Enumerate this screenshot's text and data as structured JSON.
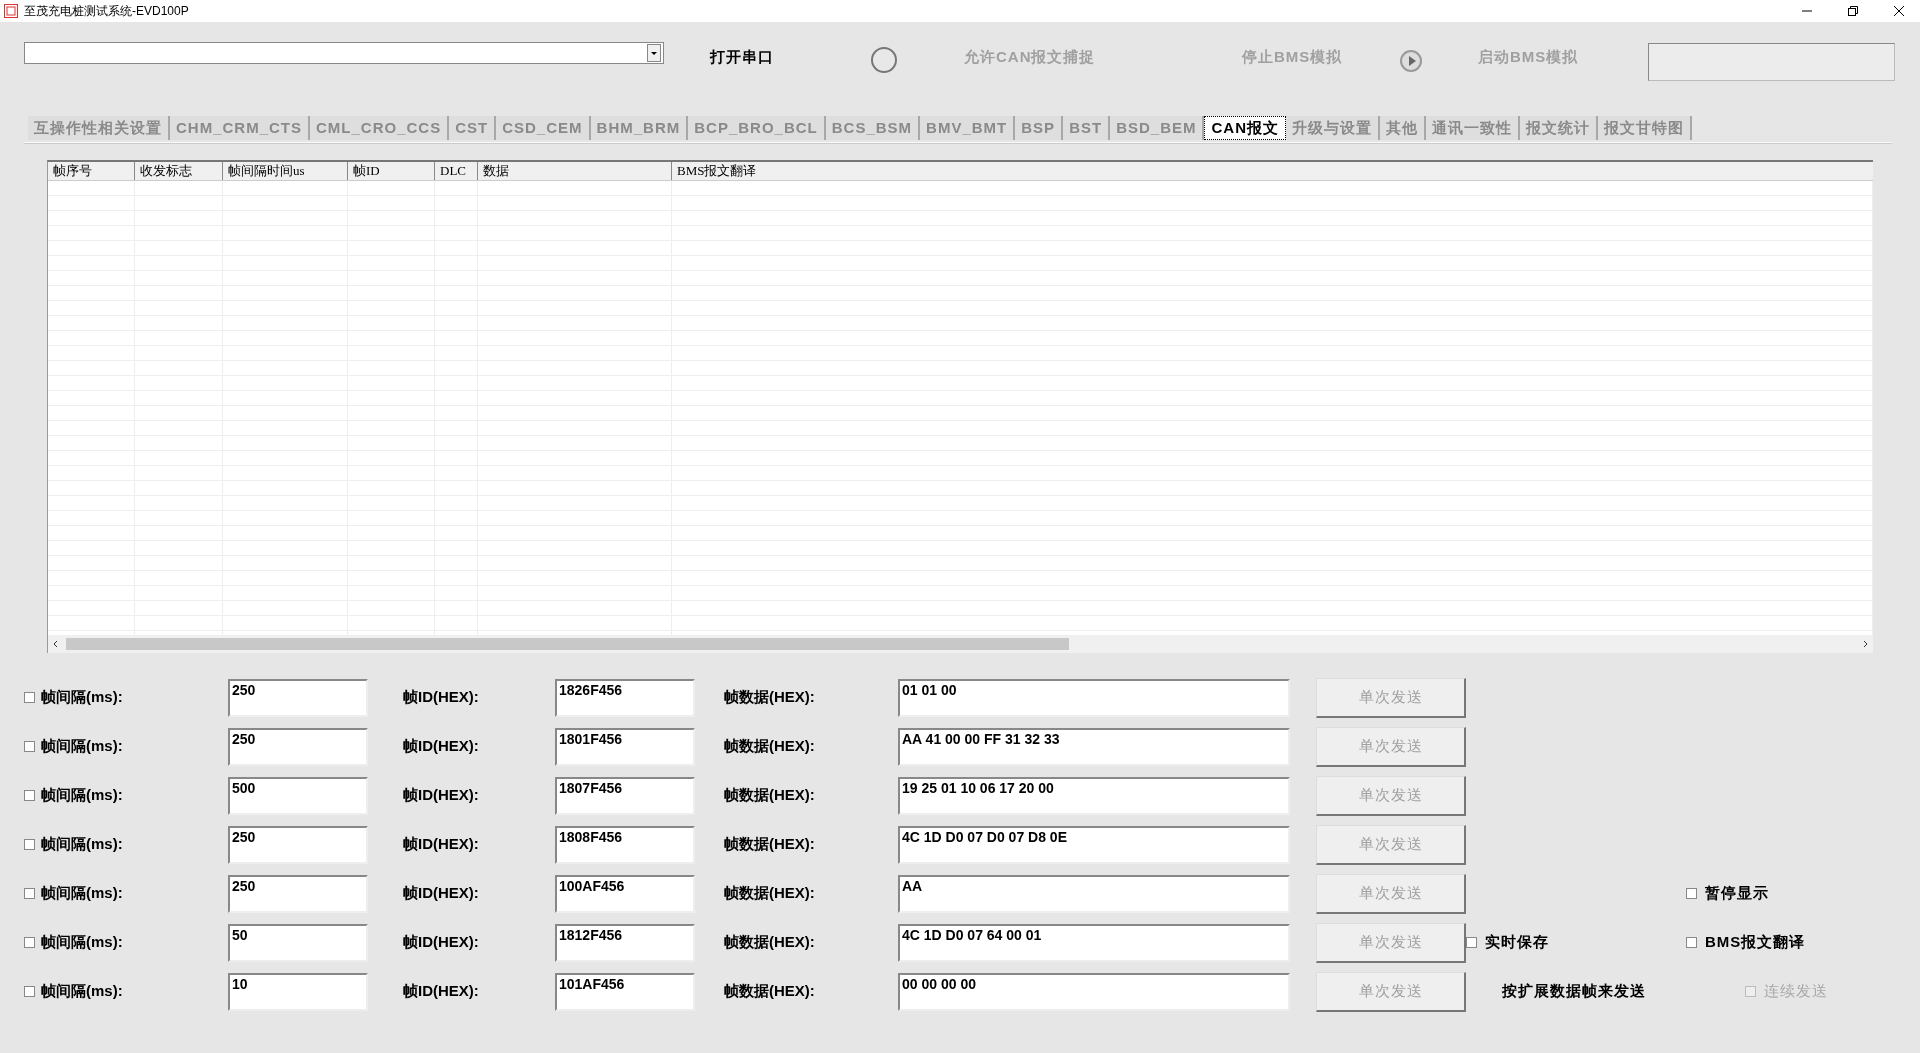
{
  "window": {
    "title": "至茂充电桩测试系统-EVD100P"
  },
  "toolbar": {
    "open_port": {
      "label": "打开串口",
      "disabled": false
    },
    "capture": {
      "label": "允许CAN报文捕捉",
      "disabled": true
    },
    "stop_bms": {
      "label": "停止BMS模拟",
      "disabled": true
    },
    "start_bms": {
      "label": "启动BMS模拟",
      "disabled": true
    }
  },
  "tabs": [
    {
      "label": "互操作性相关设置",
      "selected": false
    },
    {
      "label": "CHM_CRM_CTS",
      "selected": false
    },
    {
      "label": "CML_CRO_CCS",
      "selected": false
    },
    {
      "label": "CST",
      "selected": false
    },
    {
      "label": "CSD_CEM",
      "selected": false
    },
    {
      "label": "BHM_BRM",
      "selected": false
    },
    {
      "label": "BCP_BRO_BCL",
      "selected": false
    },
    {
      "label": "BCS_BSM",
      "selected": false
    },
    {
      "label": "BMV_BMT",
      "selected": false
    },
    {
      "label": "BSP",
      "selected": false
    },
    {
      "label": "BST",
      "selected": false
    },
    {
      "label": "BSD_BEM",
      "selected": false
    },
    {
      "label": "CAN报文",
      "selected": true
    },
    {
      "label": "升级与设置",
      "selected": false
    },
    {
      "label": "其他",
      "selected": false
    },
    {
      "label": "通讯一致性",
      "selected": false
    },
    {
      "label": "报文统计",
      "selected": false
    },
    {
      "label": "报文甘特图",
      "selected": false
    }
  ],
  "table": {
    "columns": [
      "帧序号",
      "收发标志",
      "帧间隔时间us",
      "帧ID",
      "DLC",
      "数据",
      "BMS报文翻译"
    ]
  },
  "send_rows": [
    {
      "checked": false,
      "interval_label": "帧间隔(ms):",
      "interval": "250",
      "id_label": "帧ID(HEX):",
      "id": "1826F456",
      "data_label": "帧数据(HEX):",
      "data": "01 01 00",
      "button": {
        "label": "单次发送",
        "disabled": true
      }
    },
    {
      "checked": false,
      "interval_label": "帧间隔(ms):",
      "interval": "250",
      "id_label": "帧ID(HEX):",
      "id": "1801F456",
      "data_label": "帧数据(HEX):",
      "data": "AA 41 00 00 FF 31 32 33",
      "button": {
        "label": "单次发送",
        "disabled": true
      }
    },
    {
      "checked": false,
      "interval_label": "帧间隔(ms):",
      "interval": "500",
      "id_label": "帧ID(HEX):",
      "id": "1807F456",
      "data_label": "帧数据(HEX):",
      "data": "19 25 01 10 06 17 20 00",
      "button": {
        "label": "单次发送",
        "disabled": true
      }
    },
    {
      "checked": false,
      "interval_label": "帧间隔(ms):",
      "interval": "250",
      "id_label": "帧ID(HEX):",
      "id": "1808F456",
      "data_label": "帧数据(HEX):",
      "data": "4C 1D D0 07 D0 07 D8 0E",
      "button": {
        "label": "单次发送",
        "disabled": true
      }
    },
    {
      "checked": false,
      "interval_label": "帧间隔(ms):",
      "interval": "250",
      "id_label": "帧ID(HEX):",
      "id": "100AF456",
      "data_label": "帧数据(HEX):",
      "data": "AA",
      "button": {
        "label": "单次发送",
        "disabled": true
      }
    },
    {
      "checked": false,
      "interval_label": "帧间隔(ms):",
      "interval": "50",
      "id_label": "帧ID(HEX):",
      "id": "1812F456",
      "data_label": "帧数据(HEX):",
      "data": "4C 1D D0 07 64 00 01",
      "button": {
        "label": "单次发送",
        "disabled": true
      }
    },
    {
      "checked": false,
      "interval_label": "帧间隔(ms):",
      "interval": "10",
      "id_label": "帧ID(HEX):",
      "id": "101AF456",
      "data_label": "帧数据(HEX):",
      "data": "00 00 00 00",
      "button": {
        "label": "单次发送",
        "disabled": true
      }
    }
  ],
  "options": {
    "pause_display": {
      "label": "暂停显示",
      "checked": false,
      "disabled": false
    },
    "realtime_save": {
      "label": "实时保存",
      "checked": false,
      "disabled": false
    },
    "bms_translate": {
      "label": "BMS报文翻译",
      "checked": false,
      "disabled": false
    },
    "extended_frame_label": "按扩展数据帧来发送",
    "continuous_send": {
      "label": "连续发送",
      "checked": false,
      "disabled": true
    }
  }
}
